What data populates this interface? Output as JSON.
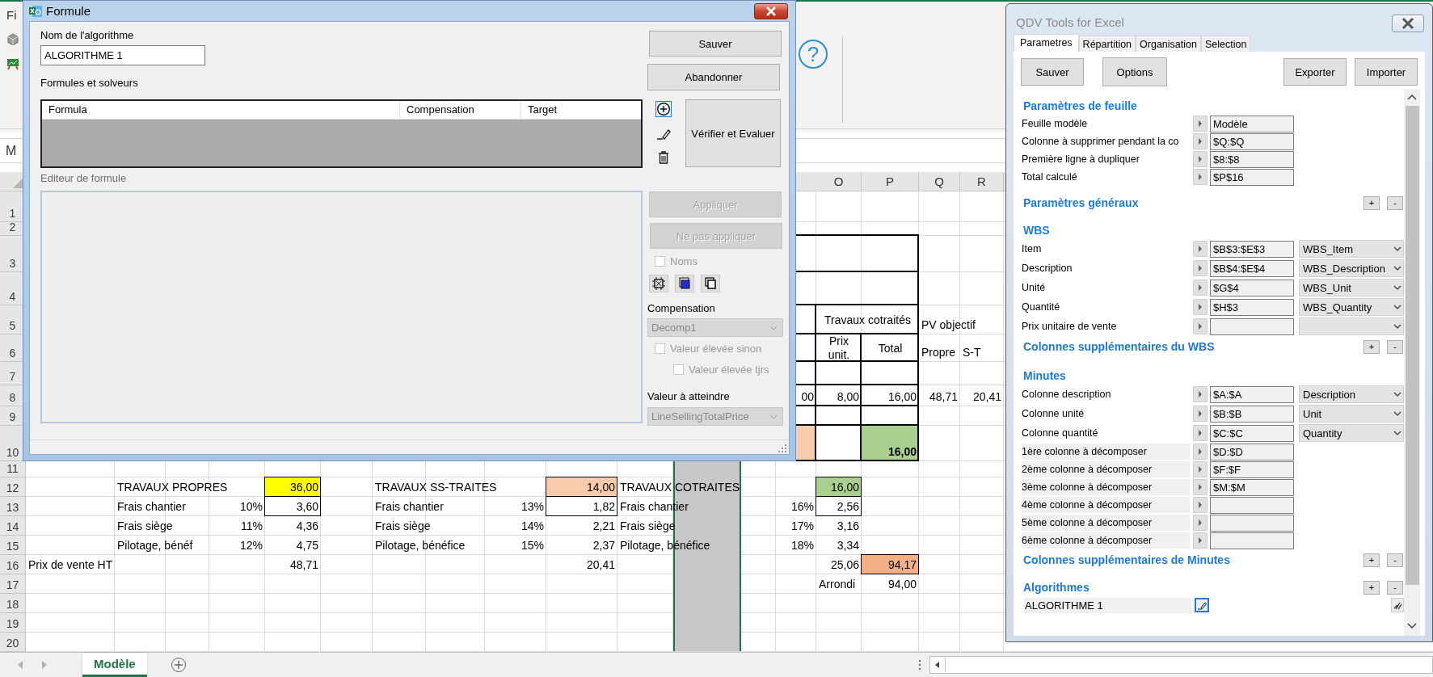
{
  "excel": {
    "file_tab": "Fi",
    "help": "?",
    "name_box": "M",
    "column_headers": [
      "O",
      "P",
      "Q",
      "R"
    ],
    "rows": [
      {
        "number": "1",
        "cells": [
          {
            "kind": "empty"
          },
          {
            "kind": "empty"
          },
          {
            "kind": "empty"
          },
          {
            "kind": "empty"
          },
          {
            "kind": "empty"
          },
          {
            "kind": "empty"
          },
          {
            "kind": "empty"
          },
          {
            "kind": "empty"
          },
          {
            "kind": "empty"
          },
          {
            "kind": "empty"
          },
          {
            "kind": "empty"
          },
          {
            "kind": "selected"
          }
        ]
      },
      {
        "number": "2",
        "cells": [
          {
            "kind": "empty"
          },
          {
            "kind": "empty"
          },
          {
            "kind": "empty"
          },
          {
            "kind": "empty"
          },
          {
            "kind": "empty"
          },
          {
            "kind": "empty"
          },
          {
            "kind": "empty"
          },
          {
            "kind": "empty"
          },
          {
            "kind": "empty"
          },
          {
            "kind": "empty"
          },
          {
            "kind": "empty"
          },
          {
            "kind": "selected"
          }
        ]
      },
      {
        "number": "3",
        "cells": [
          {
            "kind": "empty"
          },
          {
            "kind": "empty"
          },
          {
            "kind": "empty"
          },
          {
            "kind": "empty"
          },
          {
            "kind": "empty"
          },
          {
            "kind": "empty"
          },
          {
            "kind": "empty"
          },
          {
            "kind": "empty"
          },
          {
            "kind": "empty"
          },
          {
            "kind": "empty"
          },
          {
            "kind": "empty"
          },
          {
            "kind": "selected"
          },
          {
            "kind": "empty"
          },
          {
            "kind": "frame"
          },
          {
            "kind": "merged"
          },
          {
            "kind": "merged"
          }
        ]
      },
      {
        "number": "4",
        "cells": [
          {
            "kind": "empty"
          },
          {
            "kind": "empty"
          },
          {
            "kind": "empty"
          },
          {
            "kind": "empty"
          },
          {
            "kind": "empty"
          },
          {
            "kind": "empty"
          },
          {
            "kind": "empty"
          },
          {
            "kind": "empty"
          },
          {
            "kind": "empty"
          },
          {
            "kind": "empty"
          },
          {
            "kind": "empty"
          },
          {
            "kind": "selected"
          },
          {
            "kind": "empty"
          },
          {
            "kind": "frame"
          },
          {
            "kind": "merged"
          },
          {
            "kind": "merged"
          }
        ]
      },
      {
        "number": "5",
        "cells": [
          {
            "kind": "empty"
          },
          {
            "kind": "empty"
          },
          {
            "kind": "empty"
          },
          {
            "kind": "empty"
          },
          {
            "kind": "empty"
          },
          {
            "kind": "empty"
          },
          {
            "kind": "empty"
          },
          {
            "kind": "empty"
          },
          {
            "kind": "empty"
          },
          {
            "kind": "empty"
          },
          {
            "kind": "empty"
          },
          {
            "kind": "selected"
          },
          {
            "kind": "empty"
          },
          {
            "kind": "frame"
          },
          {
            "kind": "frame_heading",
            "text": "Travaux cotraités"
          },
          {
            "kind": "merged"
          },
          {
            "kind": "text",
            "text": "PV objectif"
          }
        ]
      },
      {
        "number": "6",
        "cells": [
          {
            "kind": "empty"
          },
          {
            "kind": "empty"
          },
          {
            "kind": "empty"
          },
          {
            "kind": "empty"
          },
          {
            "kind": "empty"
          },
          {
            "kind": "empty"
          },
          {
            "kind": "empty"
          },
          {
            "kind": "empty"
          },
          {
            "kind": "empty"
          },
          {
            "kind": "empty"
          },
          {
            "kind": "empty"
          },
          {
            "kind": "selected"
          },
          {
            "kind": "empty"
          },
          {
            "kind": "frame"
          },
          {
            "kind": "frame_heading",
            "text": "Prix unit."
          },
          {
            "kind": "frame_heading",
            "text": "Total"
          },
          {
            "kind": "text",
            "text": "Propre"
          },
          {
            "kind": "text",
            "text": "S-T"
          }
        ]
      },
      {
        "number": "7",
        "cells": [
          {
            "kind": "empty"
          },
          {
            "kind": "empty"
          },
          {
            "kind": "empty"
          },
          {
            "kind": "empty"
          },
          {
            "kind": "empty"
          },
          {
            "kind": "empty"
          },
          {
            "kind": "empty"
          },
          {
            "kind": "empty"
          },
          {
            "kind": "empty"
          },
          {
            "kind": "empty"
          },
          {
            "kind": "empty"
          },
          {
            "kind": "selected"
          },
          {
            "kind": "empty"
          },
          {
            "kind": "frame"
          },
          {
            "kind": "frame"
          },
          {
            "kind": "frame"
          }
        ]
      },
      {
        "number": "8",
        "cells": [
          {
            "kind": "empty"
          },
          {
            "kind": "empty"
          },
          {
            "kind": "empty"
          },
          {
            "kind": "empty"
          },
          {
            "kind": "empty"
          },
          {
            "kind": "empty"
          },
          {
            "kind": "empty"
          },
          {
            "kind": "empty"
          },
          {
            "kind": "empty"
          },
          {
            "kind": "empty"
          },
          {
            "kind": "empty"
          },
          {
            "kind": "selected"
          },
          {
            "kind": "empty"
          },
          {
            "kind": "frame_number",
            "text": "00"
          },
          {
            "kind": "frame_number",
            "text": "8,00"
          },
          {
            "kind": "frame_number",
            "text": "16,00"
          },
          {
            "kind": "number",
            "text": "48,71"
          },
          {
            "kind": "number",
            "text": "20,41"
          }
        ]
      },
      {
        "number": "9",
        "cells": [
          {
            "kind": "empty"
          },
          {
            "kind": "empty"
          },
          {
            "kind": "empty"
          },
          {
            "kind": "empty"
          },
          {
            "kind": "empty"
          },
          {
            "kind": "empty"
          },
          {
            "kind": "empty"
          },
          {
            "kind": "empty"
          },
          {
            "kind": "empty"
          },
          {
            "kind": "empty"
          },
          {
            "kind": "empty"
          },
          {
            "kind": "selected"
          },
          {
            "kind": "empty"
          },
          {
            "kind": "frame"
          },
          {
            "kind": "frame"
          },
          {
            "kind": "frame"
          }
        ]
      },
      {
        "number": "10",
        "cells": [
          {
            "kind": "empty"
          },
          {
            "kind": "empty"
          },
          {
            "kind": "empty"
          },
          {
            "kind": "empty"
          },
          {
            "kind": "empty"
          },
          {
            "kind": "empty"
          },
          {
            "kind": "empty"
          },
          {
            "kind": "empty"
          },
          {
            "kind": "empty"
          },
          {
            "kind": "empty"
          },
          {
            "kind": "empty"
          },
          {
            "kind": "selected"
          },
          {
            "kind": "empty"
          },
          {
            "kind": "frame",
            "color": "#f8cbad"
          },
          {
            "kind": "frame"
          },
          {
            "kind": "frame_number",
            "text": "16,00",
            "bold": true,
            "color": "#a9d08e"
          }
        ]
      },
      {
        "number": "11",
        "cells": [
          {
            "kind": "empty"
          },
          {
            "kind": "empty"
          },
          {
            "kind": "empty"
          },
          {
            "kind": "empty"
          },
          {
            "kind": "empty"
          },
          {
            "kind": "empty"
          },
          {
            "kind": "empty"
          },
          {
            "kind": "empty"
          },
          {
            "kind": "empty"
          },
          {
            "kind": "empty"
          },
          {
            "kind": "empty"
          },
          {
            "kind": "selected"
          }
        ]
      },
      {
        "number": "12",
        "cells": [
          {
            "kind": "empty"
          },
          {
            "kind": "text",
            "text": "TRAVAUX PROPRES"
          },
          {
            "kind": "empty"
          },
          {
            "kind": "empty"
          },
          {
            "kind": "box_number",
            "text": "36,00",
            "color": "#ffff00"
          },
          {
            "kind": "empty"
          },
          {
            "kind": "text",
            "text": "TRAVAUX SS-TRAITES"
          },
          {
            "kind": "empty"
          },
          {
            "kind": "empty"
          },
          {
            "kind": "box_number",
            "text": "14,00",
            "color": "#f8cbad"
          },
          {
            "kind": "text",
            "text": "TRAVAUX COTRAITES"
          },
          {
            "kind": "selected"
          },
          {
            "kind": "empty"
          },
          {
            "kind": "empty"
          },
          {
            "kind": "box_number",
            "text": "16,00",
            "color": "#a9d08e"
          }
        ]
      },
      {
        "number": "13",
        "cells": [
          {
            "kind": "empty"
          },
          {
            "kind": "text",
            "text": "Frais chantier"
          },
          {
            "kind": "empty"
          },
          {
            "kind": "number",
            "text": "10%"
          },
          {
            "kind": "box_number",
            "text": "3,60"
          },
          {
            "kind": "empty"
          },
          {
            "kind": "text",
            "text": "Frais chantier"
          },
          {
            "kind": "empty"
          },
          {
            "kind": "number",
            "text": "13%"
          },
          {
            "kind": "box_number",
            "text": "1,82"
          },
          {
            "kind": "text",
            "text": "Frais chantier"
          },
          {
            "kind": "selected"
          },
          {
            "kind": "empty"
          },
          {
            "kind": "number",
            "text": "16%"
          },
          {
            "kind": "box_number",
            "text": "2,56"
          }
        ]
      },
      {
        "number": "14",
        "cells": [
          {
            "kind": "empty"
          },
          {
            "kind": "text",
            "text": "Frais siège"
          },
          {
            "kind": "empty"
          },
          {
            "kind": "number",
            "text": "11%"
          },
          {
            "kind": "number",
            "text": "4,36"
          },
          {
            "kind": "empty"
          },
          {
            "kind": "text",
            "text": "Frais siège"
          },
          {
            "kind": "empty"
          },
          {
            "kind": "number",
            "text": "14%"
          },
          {
            "kind": "number",
            "text": "2,21"
          },
          {
            "kind": "text",
            "text": "Frais siège"
          },
          {
            "kind": "selected"
          },
          {
            "kind": "empty"
          },
          {
            "kind": "number",
            "text": "17%"
          },
          {
            "kind": "number",
            "text": "3,16"
          }
        ]
      },
      {
        "number": "15",
        "cells": [
          {
            "kind": "empty"
          },
          {
            "kind": "text",
            "text": "Pilotage, bénéf"
          },
          {
            "kind": "empty"
          },
          {
            "kind": "number",
            "text": "12%"
          },
          {
            "kind": "number",
            "text": "4,75"
          },
          {
            "kind": "empty"
          },
          {
            "kind": "text",
            "text": "Pilotage, bénéfice"
          },
          {
            "kind": "empty"
          },
          {
            "kind": "number",
            "text": "15%"
          },
          {
            "kind": "number",
            "text": "2,37"
          },
          {
            "kind": "text",
            "text": "Pilotage, bénéfice"
          },
          {
            "kind": "selected"
          },
          {
            "kind": "empty"
          },
          {
            "kind": "number",
            "text": "18%"
          },
          {
            "kind": "number",
            "text": "3,34"
          }
        ]
      },
      {
        "number": "16",
        "cells": [
          {
            "kind": "text",
            "text": "Prix de vente HT"
          },
          {
            "kind": "empty"
          },
          {
            "kind": "empty"
          },
          {
            "kind": "empty"
          },
          {
            "kind": "number",
            "text": "48,71"
          },
          {
            "kind": "empty"
          },
          {
            "kind": "empty"
          },
          {
            "kind": "empty"
          },
          {
            "kind": "empty"
          },
          {
            "kind": "number",
            "text": "20,41"
          },
          {
            "kind": "empty"
          },
          {
            "kind": "selected"
          },
          {
            "kind": "empty"
          },
          {
            "kind": "empty"
          },
          {
            "kind": "number",
            "text": "25,06"
          },
          {
            "kind": "box_number",
            "text": "94,17",
            "color": "#f4b084"
          }
        ]
      },
      {
        "number": "17",
        "cells": [
          {
            "kind": "empty"
          },
          {
            "kind": "empty"
          },
          {
            "kind": "empty"
          },
          {
            "kind": "empty"
          },
          {
            "kind": "empty"
          },
          {
            "kind": "empty"
          },
          {
            "kind": "empty"
          },
          {
            "kind": "empty"
          },
          {
            "kind": "empty"
          },
          {
            "kind": "empty"
          },
          {
            "kind": "empty"
          },
          {
            "kind": "selected"
          },
          {
            "kind": "empty"
          },
          {
            "kind": "empty"
          },
          {
            "kind": "text",
            "text": "Arrondi"
          },
          {
            "kind": "number",
            "text": "94,00"
          }
        ]
      },
      {
        "number": "18",
        "cells": [
          {
            "kind": "empty"
          },
          {
            "kind": "empty"
          },
          {
            "kind": "empty"
          },
          {
            "kind": "empty"
          },
          {
            "kind": "empty"
          },
          {
            "kind": "empty"
          },
          {
            "kind": "empty"
          },
          {
            "kind": "empty"
          },
          {
            "kind": "empty"
          },
          {
            "kind": "empty"
          },
          {
            "kind": "empty"
          },
          {
            "kind": "selected"
          }
        ]
      },
      {
        "number": "19",
        "cells": [
          {
            "kind": "empty"
          },
          {
            "kind": "empty"
          },
          {
            "kind": "empty"
          },
          {
            "kind": "empty"
          },
          {
            "kind": "empty"
          },
          {
            "kind": "empty"
          },
          {
            "kind": "empty"
          },
          {
            "kind": "empty"
          },
          {
            "kind": "empty"
          },
          {
            "kind": "empty"
          },
          {
            "kind": "empty"
          },
          {
            "kind": "selected"
          }
        ]
      },
      {
        "number": "20",
        "cells": [
          {
            "kind": "empty"
          },
          {
            "kind": "empty"
          },
          {
            "kind": "empty"
          },
          {
            "kind": "empty"
          },
          {
            "kind": "empty"
          },
          {
            "kind": "empty"
          },
          {
            "kind": "empty"
          },
          {
            "kind": "empty"
          },
          {
            "kind": "empty"
          },
          {
            "kind": "empty"
          },
          {
            "kind": "empty"
          },
          {
            "kind": "selected"
          }
        ]
      }
    ],
    "sheet_tabs": [
      {
        "label": "Modèle",
        "selected": true
      }
    ]
  },
  "formule_dialog": {
    "title": "Formule",
    "name_label": "Nom de l'algorithme",
    "name_value": "ALGORITHME 1",
    "formulas_label": "Formules et solveurs",
    "grid_columns": [
      "Formula",
      "Compensation",
      "Target"
    ],
    "save": "Sauver",
    "cancel": "Abandonner",
    "verify": "Vérifier et Evaluer",
    "editor_label": "Editeur de formule",
    "apply": {
      "label": "Appliquer",
      "disabled": true
    },
    "dont_apply": {
      "label": "Ne pas appliquer",
      "disabled": true
    },
    "names_check": {
      "label": "Noms",
      "checked": false,
      "disabled": true
    },
    "compensation_label": "Compensation",
    "compensation_select": {
      "value": "Decomp1",
      "disabled": true
    },
    "high_else": {
      "label": "Valeur élevée sinon",
      "checked": false,
      "disabled": true
    },
    "high_always": {
      "label": "Valeur élevée tjrs",
      "checked": false,
      "disabled": true
    },
    "target_label": "Valeur à atteindre",
    "target_select": {
      "value": "LineSellingTotalPrice",
      "disabled": true
    }
  },
  "qdv": {
    "title": "QDV Tools for Excel",
    "tabs": [
      {
        "label": "Parametres",
        "selected": true
      },
      {
        "label": "Répartition",
        "selected": false
      },
      {
        "label": "Organisation",
        "selected": false
      },
      {
        "label": "Selection",
        "selected": false
      }
    ],
    "toolbar": [
      "Sauver",
      "Options",
      "Exporter",
      "Importer"
    ],
    "sections": [
      {
        "title": "Paramètres de feuille",
        "rows": [
          {
            "kind": "field",
            "label": "Feuille modèle",
            "value": "Modèle"
          },
          {
            "kind": "field",
            "label": "Colonne à supprimer pendant la co",
            "value": "$Q:$Q"
          },
          {
            "kind": "field",
            "label": "Première ligne à dupliquer",
            "value": "$8:$8"
          },
          {
            "kind": "field",
            "label": "Total calculé",
            "value": "$P$16"
          }
        ]
      },
      {
        "title": "Paramètres généraux",
        "buttons": [
          "+",
          "-"
        ]
      },
      {
        "title": "WBS",
        "rows": [
          {
            "kind": "select",
            "label": "Item",
            "value": "$B$3:$E$3",
            "option": "WBS_Item"
          },
          {
            "kind": "select",
            "label": "Description",
            "value": "$B$4:$E$4",
            "option": "WBS_Description"
          },
          {
            "kind": "select",
            "label": "Unité",
            "value": "$G$4",
            "option": "WBS_Unit"
          },
          {
            "kind": "select",
            "label": "Quantité",
            "value": "$H$3",
            "option": "WBS_Quantity"
          },
          {
            "kind": "select",
            "label": "Prix unitaire de vente"
          }
        ]
      },
      {
        "title": "Colonnes supplémentaires du WBS",
        "buttons": [
          "+",
          "-"
        ]
      },
      {
        "title": "Minutes",
        "rows": [
          {
            "kind": "select",
            "label": "Colonne description",
            "value": "$A:$A",
            "option": "Description"
          },
          {
            "kind": "select",
            "label": "Colonne unité",
            "value": "$B:$B",
            "option": "Unit"
          },
          {
            "kind": "select",
            "label": "Colonne quantité",
            "value": "$C:$C",
            "option": "Quantity"
          },
          {
            "kind": "shaded",
            "label": "1ère colonne à décomposer",
            "value": "$D:$D"
          },
          {
            "kind": "shaded",
            "label": "2ème colonne à décomposer",
            "value": "$F:$F"
          },
          {
            "kind": "shaded",
            "label": "3ème colonne à décomposer",
            "value": "$M:$M"
          },
          {
            "kind": "shaded",
            "label": "4ème colonne à décomposer"
          },
          {
            "kind": "shaded",
            "label": "5ème colonne à décomposer"
          },
          {
            "kind": "shaded",
            "label": "6ème colonne à décomposer"
          }
        ]
      },
      {
        "title": "Colonnes supplémentaires de Minutes",
        "buttons": [
          "+",
          "-"
        ]
      },
      {
        "title": "Algorithmes",
        "buttons": [
          "+",
          "-"
        ],
        "rows": [
          {
            "kind": "algorithm",
            "label": "ALGORITHME 1"
          }
        ]
      }
    ]
  }
}
